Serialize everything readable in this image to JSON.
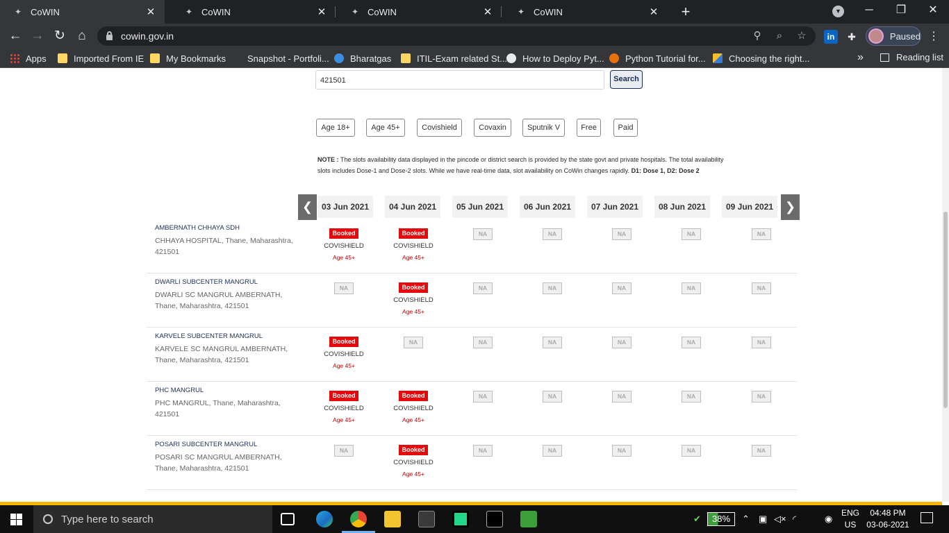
{
  "browser": {
    "tabs": [
      {
        "title": "CoWIN",
        "active": true
      },
      {
        "title": "CoWIN",
        "active": false
      },
      {
        "title": "CoWIN",
        "active": false
      },
      {
        "title": "CoWIN",
        "active": false
      }
    ],
    "url": "cowin.gov.in",
    "profile_status": "Paused",
    "bookmarks": [
      {
        "label": "Apps",
        "icon": "apps-grid-icon"
      },
      {
        "label": "Imported From IE",
        "icon": "folder-icon"
      },
      {
        "label": "My Bookmarks",
        "icon": "folder-icon"
      },
      {
        "label": "Snapshot - Portfoli...",
        "icon": "none"
      },
      {
        "label": "Bharatgas",
        "icon": "bharatgas-icon"
      },
      {
        "label": "ITIL-Exam related St...",
        "icon": "folder-icon"
      },
      {
        "label": "How to Deploy Pyt...",
        "icon": "globe-icon"
      },
      {
        "label": "Python Tutorial for...",
        "icon": "python-tutorial-icon"
      },
      {
        "label": "Choosing the right...",
        "icon": "choosing-icon"
      }
    ],
    "reading_list": "Reading list"
  },
  "search": {
    "value": "421501",
    "button": "Search"
  },
  "filters": [
    "Age 18+",
    "Age 45+",
    "Covishield",
    "Covaxin",
    "Sputnik V",
    "Free",
    "Paid"
  ],
  "note": {
    "label": "NOTE :",
    "text": "The slots availability data displayed in the pincode or district search is provided by the state govt and private hospitals. The total availability slots includes Dose-1 and Dose-2 slots. While we have real-time data, slot availability on CoWin changes rapidly.",
    "legend": "D1: Dose 1, D2: Dose 2"
  },
  "dates": [
    "03 Jun 2021",
    "04 Jun 2021",
    "05 Jun 2021",
    "06 Jun 2021",
    "07 Jun 2021",
    "08 Jun 2021",
    "09 Jun 2021"
  ],
  "centers": [
    {
      "name": "AMBERNATH CHHAYA SDH",
      "address": "CHHAYA HOSPITAL, Thane, Maharashtra, 421501",
      "slots": [
        {
          "status": "Booked",
          "vaccine": "COVISHIELD",
          "age": "Age 45+"
        },
        {
          "status": "Booked",
          "vaccine": "COVISHIELD",
          "age": "Age 45+"
        },
        {
          "status": "NA"
        },
        {
          "status": "NA"
        },
        {
          "status": "NA"
        },
        {
          "status": "NA"
        },
        {
          "status": "NA"
        }
      ]
    },
    {
      "name": "DWARLI SUBCENTER MANGRUL",
      "address": "DWARLI SC MANGRUL AMBERNATH, Thane, Maharashtra, 421501",
      "slots": [
        {
          "status": "NA"
        },
        {
          "status": "Booked",
          "vaccine": "COVISHIELD",
          "age": "Age 45+"
        },
        {
          "status": "NA"
        },
        {
          "status": "NA"
        },
        {
          "status": "NA"
        },
        {
          "status": "NA"
        },
        {
          "status": "NA"
        }
      ]
    },
    {
      "name": "KARVELE SUBCENTER MANGRUL",
      "address": "KARVELE SC MANGRUL AMBERNATH, Thane, Maharashtra, 421501",
      "slots": [
        {
          "status": "Booked",
          "vaccine": "COVISHIELD",
          "age": "Age 45+"
        },
        {
          "status": "NA"
        },
        {
          "status": "NA"
        },
        {
          "status": "NA"
        },
        {
          "status": "NA"
        },
        {
          "status": "NA"
        },
        {
          "status": "NA"
        }
      ]
    },
    {
      "name": "PHC MANGRUL",
      "address": "PHC MANGRUL, Thane, Maharashtra, 421501",
      "slots": [
        {
          "status": "Booked",
          "vaccine": "COVISHIELD",
          "age": "Age 45+"
        },
        {
          "status": "Booked",
          "vaccine": "COVISHIELD",
          "age": "Age 45+"
        },
        {
          "status": "NA"
        },
        {
          "status": "NA"
        },
        {
          "status": "NA"
        },
        {
          "status": "NA"
        },
        {
          "status": "NA"
        }
      ]
    },
    {
      "name": "POSARI SUBCENTER MANGRUL",
      "address": "POSARI SC MANGRUL AMBERNATH, Thane, Maharashtra, 421501",
      "slots": [
        {
          "status": "NA"
        },
        {
          "status": "Booked",
          "vaccine": "COVISHIELD",
          "age": "Age 45+"
        },
        {
          "status": "NA"
        },
        {
          "status": "NA"
        },
        {
          "status": "NA"
        },
        {
          "status": "NA"
        },
        {
          "status": "NA"
        }
      ]
    }
  ],
  "taskbar": {
    "search_placeholder": "Type here to search",
    "battery": "38%",
    "language": "ENG",
    "region": "US",
    "time": "04:48 PM",
    "date": "03-06-2021"
  },
  "colors": {
    "booked": "#e6080b",
    "age_text": "#b80000",
    "navy": "#1d2f55",
    "accent_bar": "#f4b602"
  }
}
